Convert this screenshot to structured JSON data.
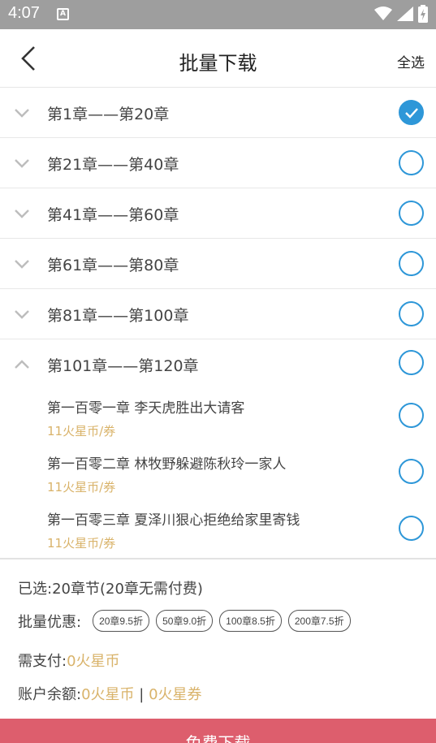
{
  "status": {
    "time": "4:07",
    "notif": "A"
  },
  "header": {
    "title": "批量下载",
    "select_all": "全选"
  },
  "groups": [
    {
      "label": "第1章——第20章",
      "checked": true,
      "expanded": false
    },
    {
      "label": "第21章——第40章",
      "checked": false,
      "expanded": false
    },
    {
      "label": "第41章——第60章",
      "checked": false,
      "expanded": false
    },
    {
      "label": "第61章——第80章",
      "checked": false,
      "expanded": false
    },
    {
      "label": "第81章——第100章",
      "checked": false,
      "expanded": false
    },
    {
      "label": "第101章——第120章",
      "checked": false,
      "expanded": true
    }
  ],
  "chapters": [
    {
      "title": "第一百零一章 李天虎胜出大请客",
      "price": "11火星币/券"
    },
    {
      "title": "第一百零二章 林牧野躲避陈秋玲一家人",
      "price": "11火星币/券"
    },
    {
      "title": "第一百零三章 夏泽川狠心拒绝给家里寄钱",
      "price": "11火星币/券"
    }
  ],
  "summary": {
    "selected": "已选:20章节(20章无需付费)",
    "discount_label": "批量优惠:",
    "discounts": [
      "20章9.5折",
      "50章9.0折",
      "100章8.5折",
      "200章7.5折"
    ],
    "pay_label": "需支付:",
    "pay_value": "0火星币",
    "balance_label": "账户余额:",
    "balance_coins": "0火星币",
    "balance_sep": "|",
    "balance_coupons": "0火星券"
  },
  "button": {
    "label": "免费下载"
  },
  "colors": {
    "accent": "#2e97d8",
    "gold": "#d9b36a",
    "button": "#dd5e6d",
    "status_bar": "#9e9e9e"
  }
}
